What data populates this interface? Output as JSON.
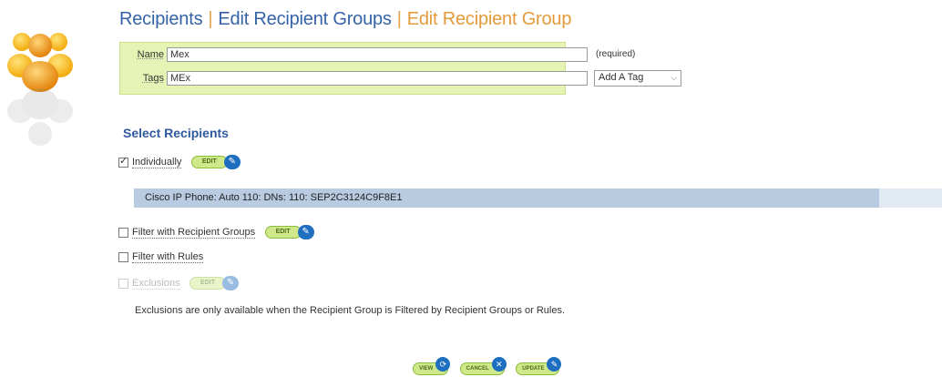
{
  "breadcrumb": {
    "item1": "Recipients",
    "sep1": "|",
    "item2": "Edit Recipient Groups",
    "sep2": "|",
    "current": "Edit Recipient Group"
  },
  "form": {
    "name_label": "Name",
    "name_value": "Mex",
    "required_note": "(required)",
    "tags_label": "Tags",
    "tags_value": "MEx",
    "add_tag_label": "Add A Tag"
  },
  "section_title": "Select Recipients",
  "options": {
    "individually": {
      "label": "Individually",
      "checked": true
    },
    "filter_groups": {
      "label": "Filter with Recipient Groups",
      "checked": false
    },
    "filter_rules": {
      "label": "Filter with Rules",
      "checked": false
    },
    "exclusions": {
      "label": "Exclusions",
      "checked": false,
      "disabled": true
    }
  },
  "edit_label": "EDIT",
  "selected_recipient": "Cisco IP Phone: Auto 110: DNs: 110: SEP2C3124C9F8E1",
  "exclusions_note": "Exclusions are only available when the Recipient Group is Filtered by Recipient Groups or Rules.",
  "actions": {
    "view": "VIEW",
    "cancel": "CANCEL",
    "update": "UPDATE"
  },
  "colors": {
    "link": "#3563a8",
    "current": "#e39a3b",
    "panel_bg": "#e5f4b4",
    "selected_bar": "#b8cbe1",
    "button_blue": "#1f6fc1",
    "button_green": "#cfe98a"
  }
}
